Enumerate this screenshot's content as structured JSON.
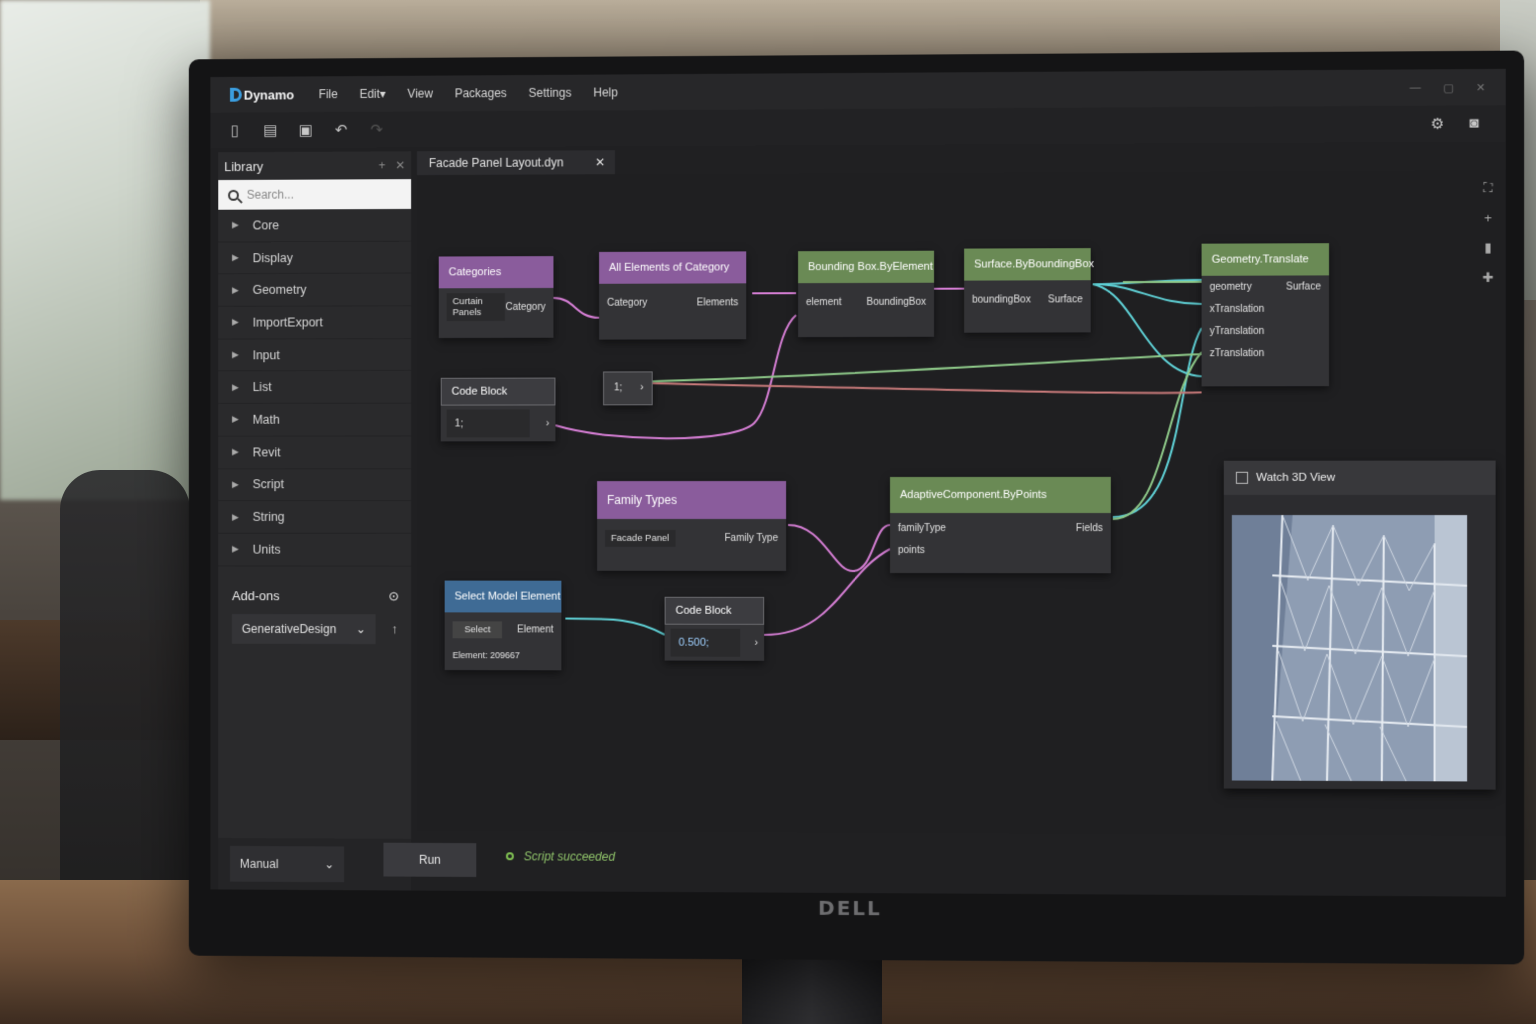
{
  "app": {
    "name": "Dynamo"
  },
  "menu": [
    "File",
    "Edit",
    "View",
    "Packages",
    "Settings",
    "Help"
  ],
  "menu_edit_suffix": "▾",
  "toolbar_icons": [
    "new-file-icon",
    "open-folder-icon",
    "save-icon",
    "undo-icon",
    "redo-icon"
  ],
  "toolbar_right_icons": [
    "gear-icon",
    "camera-icon"
  ],
  "library": {
    "title": "Library",
    "search_placeholder": "Search...",
    "categories": [
      "Core",
      "Display",
      "Geometry",
      "ImportExport",
      "Input",
      "List",
      "Math",
      "Revit",
      "Script",
      "String",
      "Units"
    ],
    "addons_title": "Add-ons",
    "addon_selected": "GenerativeDesign"
  },
  "run": {
    "mode": "Manual",
    "button": "Run",
    "status": "Script succeeded"
  },
  "tab": {
    "title": "Facade Panel Layout.dyn"
  },
  "nodes": {
    "categories": {
      "title": "Categories",
      "value": "Curtain Panels",
      "output": "Category"
    },
    "all_elements": {
      "title": "All Elements of Category",
      "input": "Category",
      "output": "Elements"
    },
    "bbox_element": {
      "title": "Bounding Box.ByElement",
      "input": "element",
      "output": "BoundingBox"
    },
    "surface_bbox": {
      "title": "Surface.ByBoundingBox",
      "input": "boundingBox",
      "output": "Surface"
    },
    "translate": {
      "title": "Geometry.Translate",
      "inputs": [
        "geometry",
        "xTranslation",
        "yTranslation",
        "zTranslation"
      ],
      "output": "Surface"
    },
    "code_block_1": {
      "title": "Code Block",
      "value": "1;"
    },
    "code_block_mini": {
      "value": "1;"
    },
    "family_types": {
      "title": "Family Types",
      "value": "Facade Panel",
      "output": "Family Type"
    },
    "adaptive": {
      "title": "AdaptiveComponent.ByPoints",
      "inputs": [
        "familyType",
        "points"
      ],
      "output": "Fields"
    },
    "select_model": {
      "title": "Select Model Element",
      "button": "Select",
      "output": "Element",
      "info": "Element: 209667"
    },
    "code_block_2": {
      "title": "Code Block",
      "value": "0.500;"
    },
    "watch3d": {
      "title": "Watch 3D View"
    }
  },
  "colors": {
    "purple_header": "#8a5c9c",
    "green_header": "#6a8a55",
    "blue_header": "#3f6b95",
    "wire_pink": "#d77fd6",
    "wire_cyan": "#5fd1d6",
    "wire_green": "#8fca8a",
    "wire_red": "#c87a7a",
    "status_green": "#8fc36a"
  }
}
